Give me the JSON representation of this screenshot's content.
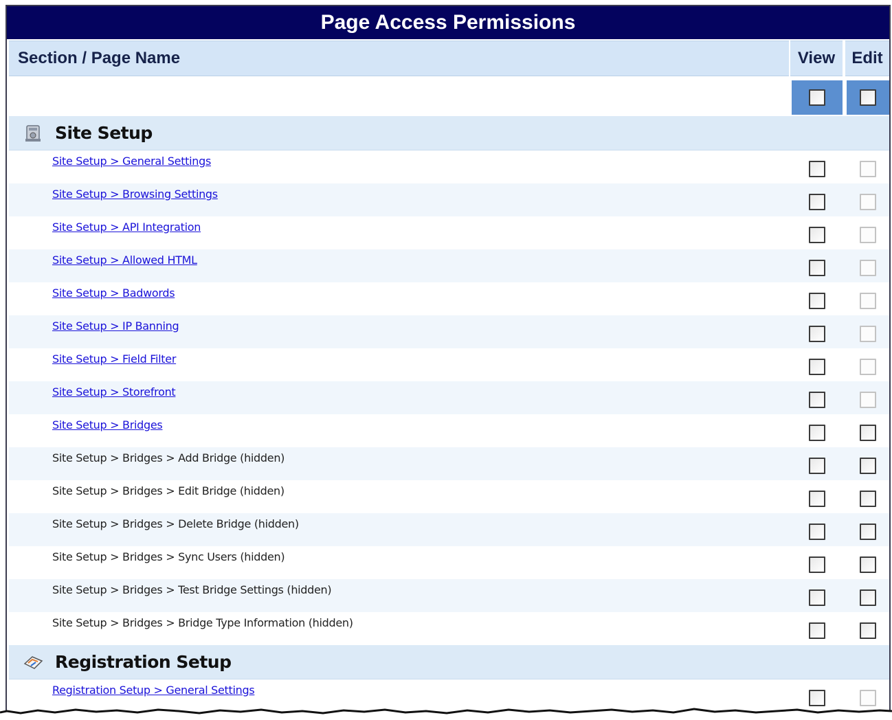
{
  "title": "Page Access Permissions",
  "columns": {
    "name": "Section / Page Name",
    "view": "View",
    "edit": "Edit"
  },
  "sections": [
    {
      "label": "Site Setup",
      "icon": "site-setup-icon",
      "items": [
        {
          "label": "Site Setup > General Settings",
          "link": true,
          "view": false,
          "edit_enabled": false
        },
        {
          "label": "Site Setup > Browsing Settings",
          "link": true,
          "view": false,
          "edit_enabled": false
        },
        {
          "label": "Site Setup > API Integration",
          "link": true,
          "view": false,
          "edit_enabled": false
        },
        {
          "label": "Site Setup > Allowed HTML",
          "link": true,
          "view": false,
          "edit_enabled": false
        },
        {
          "label": "Site Setup > Badwords",
          "link": true,
          "view": false,
          "edit_enabled": false
        },
        {
          "label": "Site Setup > IP Banning",
          "link": true,
          "view": false,
          "edit_enabled": false
        },
        {
          "label": "Site Setup > Field Filter",
          "link": true,
          "view": false,
          "edit_enabled": false
        },
        {
          "label": "Site Setup > Storefront",
          "link": true,
          "view": false,
          "edit_enabled": false
        },
        {
          "label": "Site Setup > Bridges",
          "link": true,
          "view": false,
          "edit_enabled": true
        },
        {
          "label": "Site Setup > Bridges > Add Bridge (hidden)",
          "link": false,
          "view": false,
          "edit_enabled": true
        },
        {
          "label": "Site Setup > Bridges > Edit Bridge (hidden)",
          "link": false,
          "view": false,
          "edit_enabled": true
        },
        {
          "label": "Site Setup > Bridges > Delete Bridge (hidden)",
          "link": false,
          "view": false,
          "edit_enabled": true
        },
        {
          "label": "Site Setup > Bridges > Sync Users (hidden)",
          "link": false,
          "view": false,
          "edit_enabled": true
        },
        {
          "label": "Site Setup > Bridges > Test Bridge Settings (hidden)",
          "link": false,
          "view": false,
          "edit_enabled": true
        },
        {
          "label": "Site Setup > Bridges > Bridge Type Information (hidden)",
          "link": false,
          "view": false,
          "edit_enabled": true
        }
      ]
    },
    {
      "label": "Registration Setup",
      "icon": "registration-setup-icon",
      "items": [
        {
          "label": "Registration Setup > General Settings",
          "link": true,
          "view": false,
          "edit_enabled": false
        }
      ]
    }
  ]
}
